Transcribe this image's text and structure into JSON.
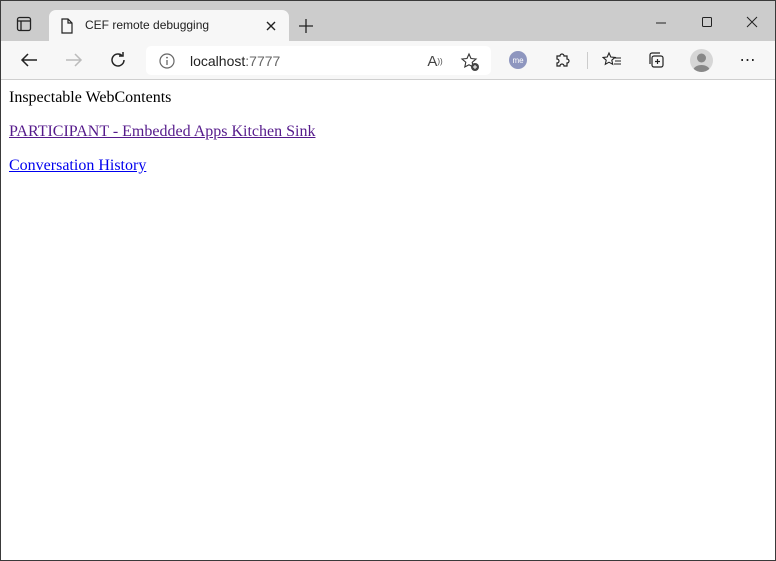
{
  "browser": {
    "tab_title": "CEF remote debugging",
    "address": {
      "host": "localhost",
      "port": ":7777"
    },
    "colors": {
      "titlebar": "#cccccc",
      "toolbar": "#f7f7f7",
      "link": "#0000ee",
      "visited_link": "#551a8b"
    },
    "extension_label": "me"
  },
  "page": {
    "heading": "Inspectable WebContents",
    "links": [
      {
        "label": "PARTICIPANT - Embedded Apps Kitchen Sink",
        "visited": true
      },
      {
        "label": "Conversation History",
        "visited": false
      }
    ]
  }
}
